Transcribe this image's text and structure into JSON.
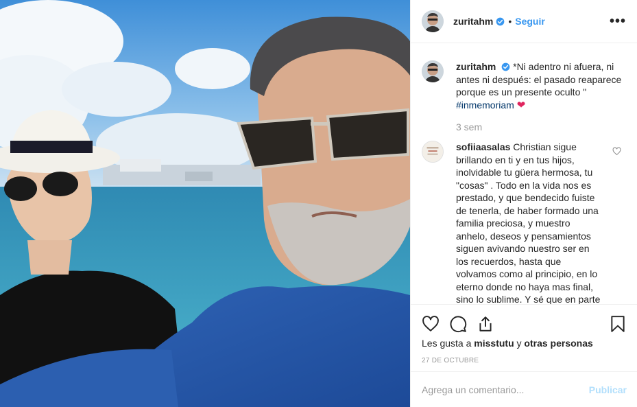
{
  "post": {
    "author": "zuritahm",
    "follow_label": "Seguir",
    "separator": "•",
    "more_label": "•••",
    "photo_alt": "Selfie de una pareja frente al mar"
  },
  "caption": {
    "username": "zuritahm",
    "text": "*Ni adentro ni afuera, ni antes ni después: el pasado reaparece porque es un presente oculto \"",
    "hashtag": "#inmemoriam",
    "emoji": "❤",
    "time": "3 sem"
  },
  "comment": {
    "username": "sofiiaasalas",
    "text": "Christian sigue brillando en ti y en tus hijos, inolvidable tu güera hermosa, tu \"cosas\" . Todo en la vida nos es prestado, y que bendecido fuiste de tenerla, de haber formado una familia preciosa, y muestro anhelo, deseos y pensamientos siguen avivando nuestro ser en los recuerdos, hasta que volvamos como al principio, en lo eterno donde no haya mas final, sino lo sublime. Y sé que en parte"
  },
  "likes": {
    "prefix": "Les gusta a",
    "user": "misstutu",
    "connector": "y",
    "others": "otras personas"
  },
  "date": "27 DE OCTUBRE",
  "add_comment": {
    "placeholder": "Agrega un comentario...",
    "publish_label": "Publicar"
  },
  "colors": {
    "accent": "#3897f0",
    "publish_disabled": "#b2dffc",
    "hashtag": "#003569",
    "heart": "#e0245e",
    "muted": "#999999"
  },
  "icons": [
    "verified-icon",
    "more-icon",
    "heart-icon",
    "comment-icon",
    "share-icon",
    "bookmark-icon"
  ]
}
